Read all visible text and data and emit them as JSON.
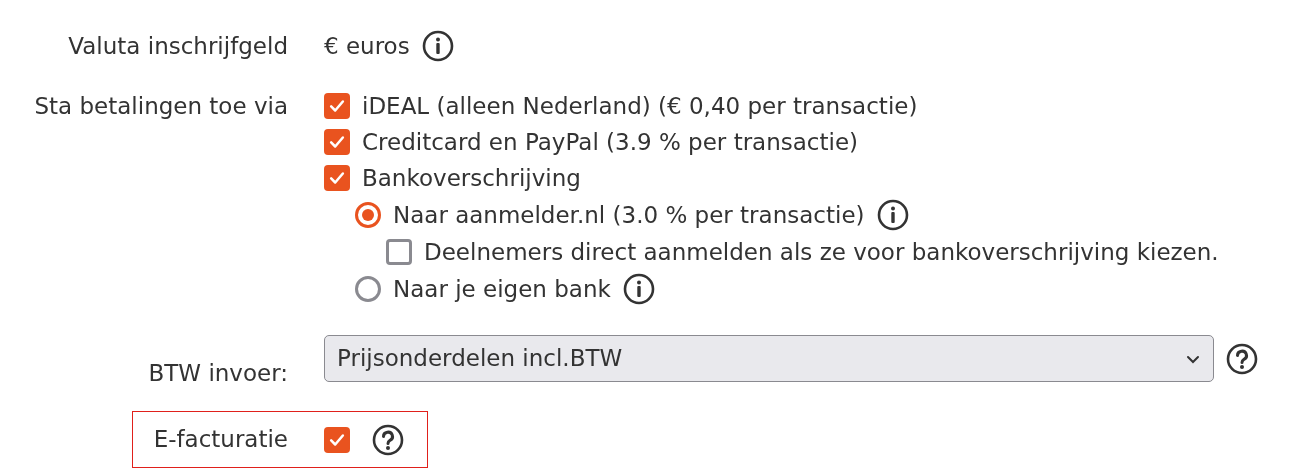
{
  "currency": {
    "label": "Valuta inschrijfgeld",
    "value": "€ euros",
    "info": true
  },
  "payments": {
    "label": "Sta betalingen toe via",
    "methods": [
      {
        "kind": "checkbox",
        "label": "iDEAL (alleen Nederland) (€ 0,40 per transactie)",
        "checked": true
      },
      {
        "kind": "checkbox",
        "label": "Creditcard en PayPal (3.9 % per transactie)",
        "checked": true
      },
      {
        "kind": "checkbox",
        "label": "Bankoverschrijving",
        "checked": true,
        "options": [
          {
            "kind": "radio",
            "label": "Naar aanmelder.nl (3.0 % per transactie)",
            "selected": true,
            "info": true,
            "children": [
              {
                "kind": "checkbox",
                "label": "Deelnemers direct aanmelden als ze voor bankoverschrijving kiezen.",
                "checked": false
              }
            ]
          },
          {
            "kind": "radio",
            "label": "Naar je eigen bank",
            "selected": false,
            "info": true
          }
        ]
      }
    ]
  },
  "vat": {
    "label": "BTW invoer:",
    "value": "Prijsonderdelen incl.BTW"
  },
  "e_invoicing": {
    "label": "E-facturatie",
    "checked": true,
    "highlighted": true
  }
}
